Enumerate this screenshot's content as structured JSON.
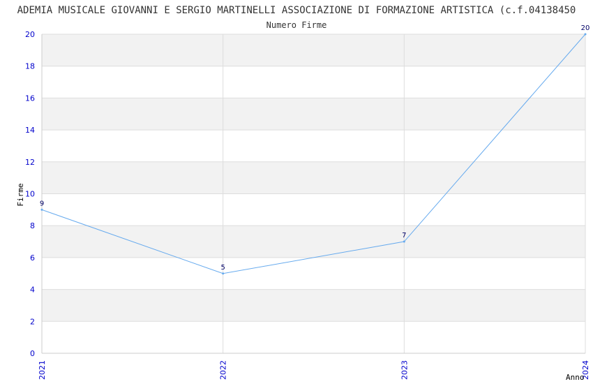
{
  "chart_data": {
    "type": "line",
    "title": "ADEMIA MUSICALE GIOVANNI E SERGIO MARTINELLI ASSOCIAZIONE DI FORMAZIONE ARTISTICA (c.f.04138450",
    "subtitle": "Numero Firme",
    "xlabel": "Anno",
    "ylabel": "Firme",
    "x": [
      "2021",
      "2022",
      "2023",
      "2024"
    ],
    "series": [
      {
        "values": [
          9,
          5,
          7,
          20
        ]
      }
    ],
    "data_labels": [
      "9",
      "5",
      "7",
      "20"
    ],
    "ylim": [
      0,
      20
    ],
    "yticks": [
      "0",
      "2",
      "4",
      "6",
      "8",
      "10",
      "12",
      "14",
      "16",
      "18",
      "20"
    ],
    "grid": true,
    "colors": {
      "line": "#66aaee",
      "band": "#f2f2f2",
      "tick_text": "#0000cc",
      "label_text": "#000066"
    }
  }
}
